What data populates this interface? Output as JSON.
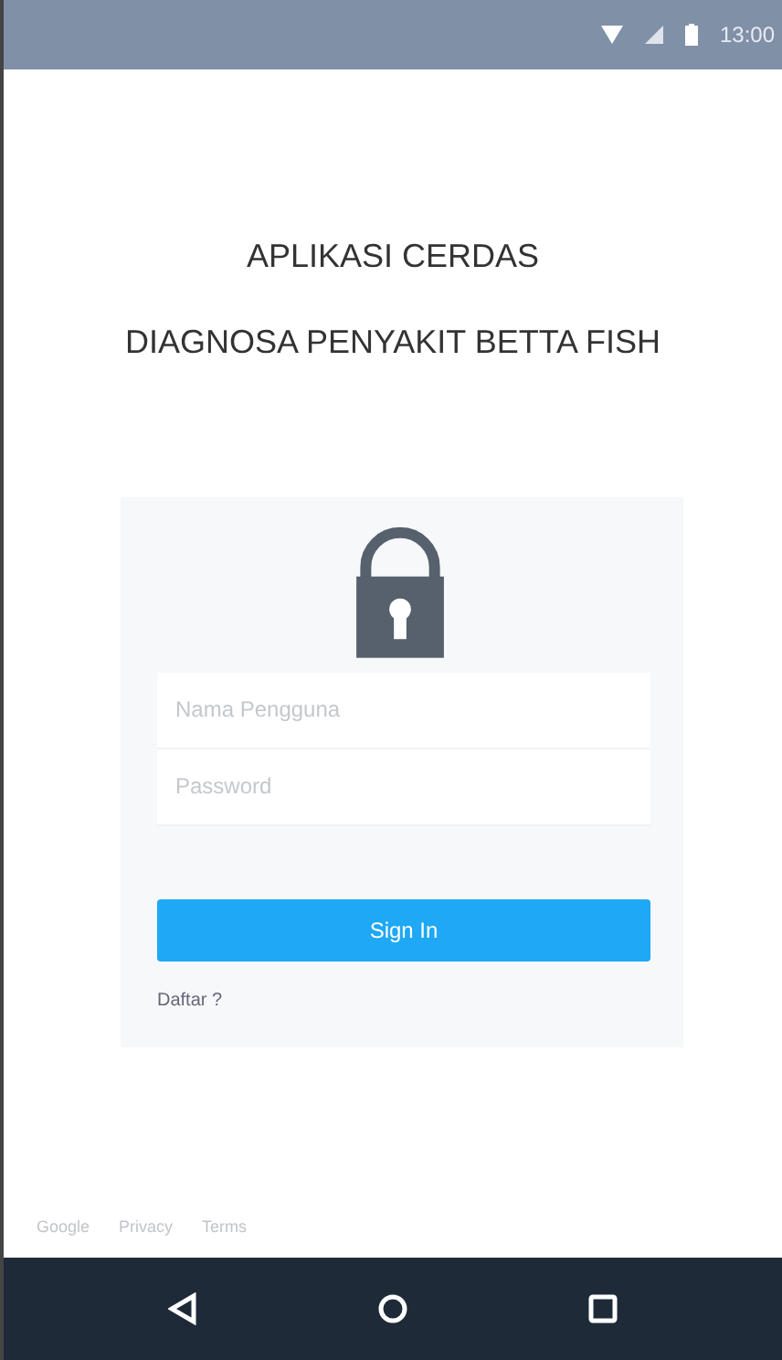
{
  "status_bar": {
    "time": "13:00"
  },
  "title_lines": [
    "APLIKASI CERDAS",
    "DIAGNOSA PENYAKIT BETTA FISH"
  ],
  "login": {
    "fields": [
      {
        "placeholder": "Nama Pengguna"
      },
      {
        "placeholder": "Password"
      }
    ],
    "button": "Sign In",
    "register_link": "Daftar ?"
  },
  "footer_links": [
    "Google",
    "Privacy",
    "Terms"
  ]
}
